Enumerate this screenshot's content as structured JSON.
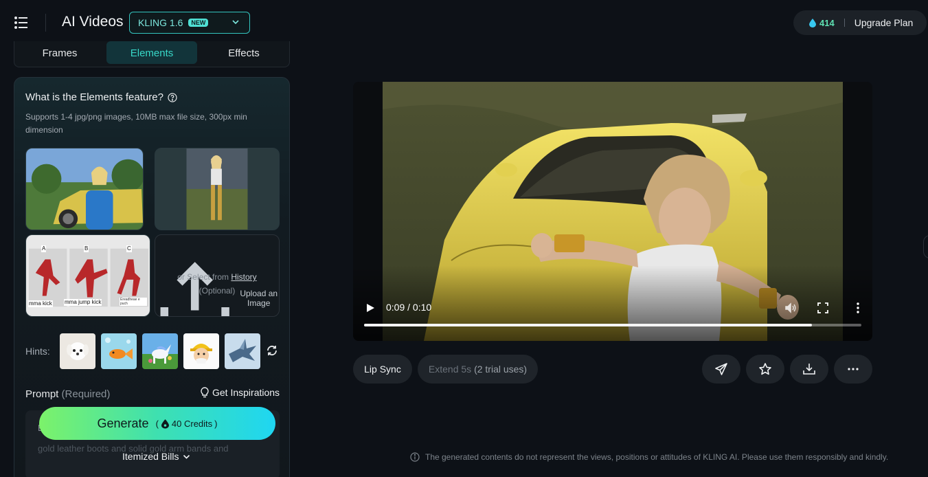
{
  "header": {
    "title": "AI Videos",
    "model": "KLING 1.6",
    "model_badge": "NEW",
    "credits": "414",
    "upgrade": "Upgrade Plan"
  },
  "tabs": [
    {
      "label": "Frames"
    },
    {
      "label": "Elements"
    },
    {
      "label": "Effects"
    }
  ],
  "elements": {
    "title": "What is the Elements feature?",
    "description": "Supports 1-4 jpg/png images, 10MB max file size, 300px min dimension",
    "pose_labels": [
      "A",
      "B",
      "C"
    ],
    "pose_captions": [
      "mma kick",
      "mma jump kick",
      "Ereadheae e puch"
    ],
    "upload_title": "Upload an Image",
    "upload_select_prefix": "or Select from",
    "upload_history": "History",
    "upload_optional": "(Optional)"
  },
  "hints": {
    "label": "Hints:"
  },
  "prompt": {
    "label": "Prompt",
    "required": "(Required)",
    "inspirations": "Get Inspirations",
    "text_first_char": "E",
    "text_fragment": "gold leather boots and solid gold arm bands and"
  },
  "generate": {
    "label": "Generate",
    "credits": "40 Credits"
  },
  "bills": {
    "label": "Itemized Bills"
  },
  "video": {
    "time": "0:09 / 0:10",
    "progress": 0.9
  },
  "actions": {
    "lip_sync": "Lip Sync",
    "extend_prefix": "Extend 5s",
    "extend_suffix": "(2 trial uses)"
  },
  "disclaimer": "The generated contents do not represent the views, positions or attitudes of KLING AI. Please use them responsibly and kindly.",
  "colors": {
    "accent": "#38d8c8",
    "credit": "#5ee0b2",
    "bg": "#0d1117"
  }
}
